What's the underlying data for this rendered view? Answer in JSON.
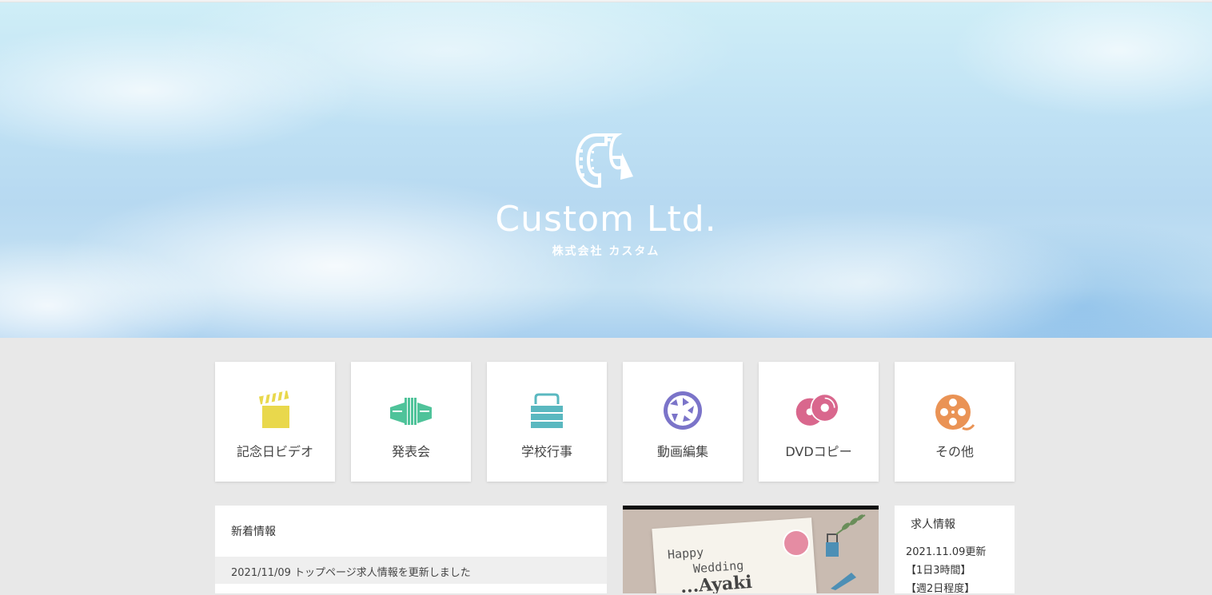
{
  "brand": {
    "name": "Custom Ltd.",
    "subtitle": "株式会社 カスタム"
  },
  "categories": [
    {
      "label": "記念日ビデオ",
      "icon": "clapperboard-icon",
      "color": "#e9d84c"
    },
    {
      "label": "発表会",
      "icon": "accordion-icon",
      "color": "#4fc39a"
    },
    {
      "label": "学校行事",
      "icon": "bag-icon",
      "color": "#5ab8c0"
    },
    {
      "label": "動画編集",
      "icon": "camera-aperture-icon",
      "color": "#7b74c9"
    },
    {
      "label": "DVDコピー",
      "icon": "dvd-icon",
      "color": "#d9678d"
    },
    {
      "label": "その他",
      "icon": "film-reel-icon",
      "color": "#ea9355"
    }
  ],
  "news": {
    "title": "新着情報",
    "items": [
      {
        "text": "2021/11/09 トップページ求人情報を更新しました"
      }
    ]
  },
  "photo": {
    "line1": "Happy",
    "line2": "Wedding",
    "line3": "...Ayaki"
  },
  "jobs": {
    "title": "求人情報",
    "lines": [
      "2021.11.09更新",
      "【1日3時間】",
      "【週2日程度】"
    ]
  }
}
